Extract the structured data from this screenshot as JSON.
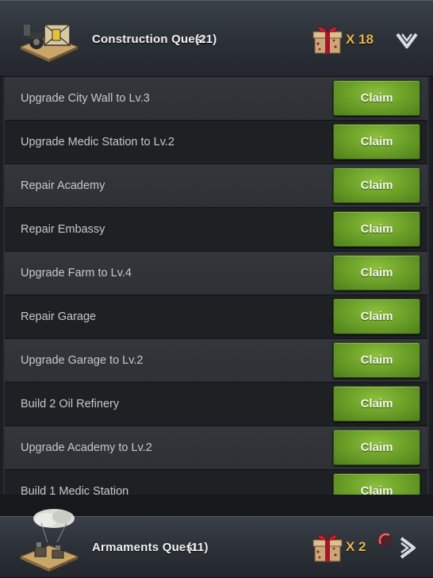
{
  "construction_quest": {
    "title": "Construction Quest",
    "count": "(21)",
    "reward_count": "X 18"
  },
  "quests": [
    {
      "label": "Upgrade  City Wall  to Lv.3",
      "button": "Claim"
    },
    {
      "label": "Upgrade  Medic Station  to Lv.2",
      "button": "Claim"
    },
    {
      "label": "Repair Academy",
      "button": "Claim"
    },
    {
      "label": "Repair Embassy",
      "button": "Claim"
    },
    {
      "label": "Upgrade  Farm  to Lv.4",
      "button": "Claim"
    },
    {
      "label": "Repair Garage",
      "button": "Claim"
    },
    {
      "label": "Upgrade  Garage  to Lv.2",
      "button": "Claim"
    },
    {
      "label": "Build 2  Oil Refinery",
      "button": "Claim"
    },
    {
      "label": "Upgrade  Academy  to Lv.2",
      "button": "Claim"
    },
    {
      "label": "Build 1  Medic Station",
      "button": "Claim"
    }
  ],
  "armaments_quest": {
    "title": "Armaments Quest",
    "count": "(11)",
    "reward_count": "X 2"
  },
  "icons": {
    "construction": "construction-building-icon",
    "armaments": "armaments-building-icon",
    "reward": "gift-box-icon",
    "collapse": "chevron-down-icon",
    "expand": "chevron-right-icon"
  }
}
